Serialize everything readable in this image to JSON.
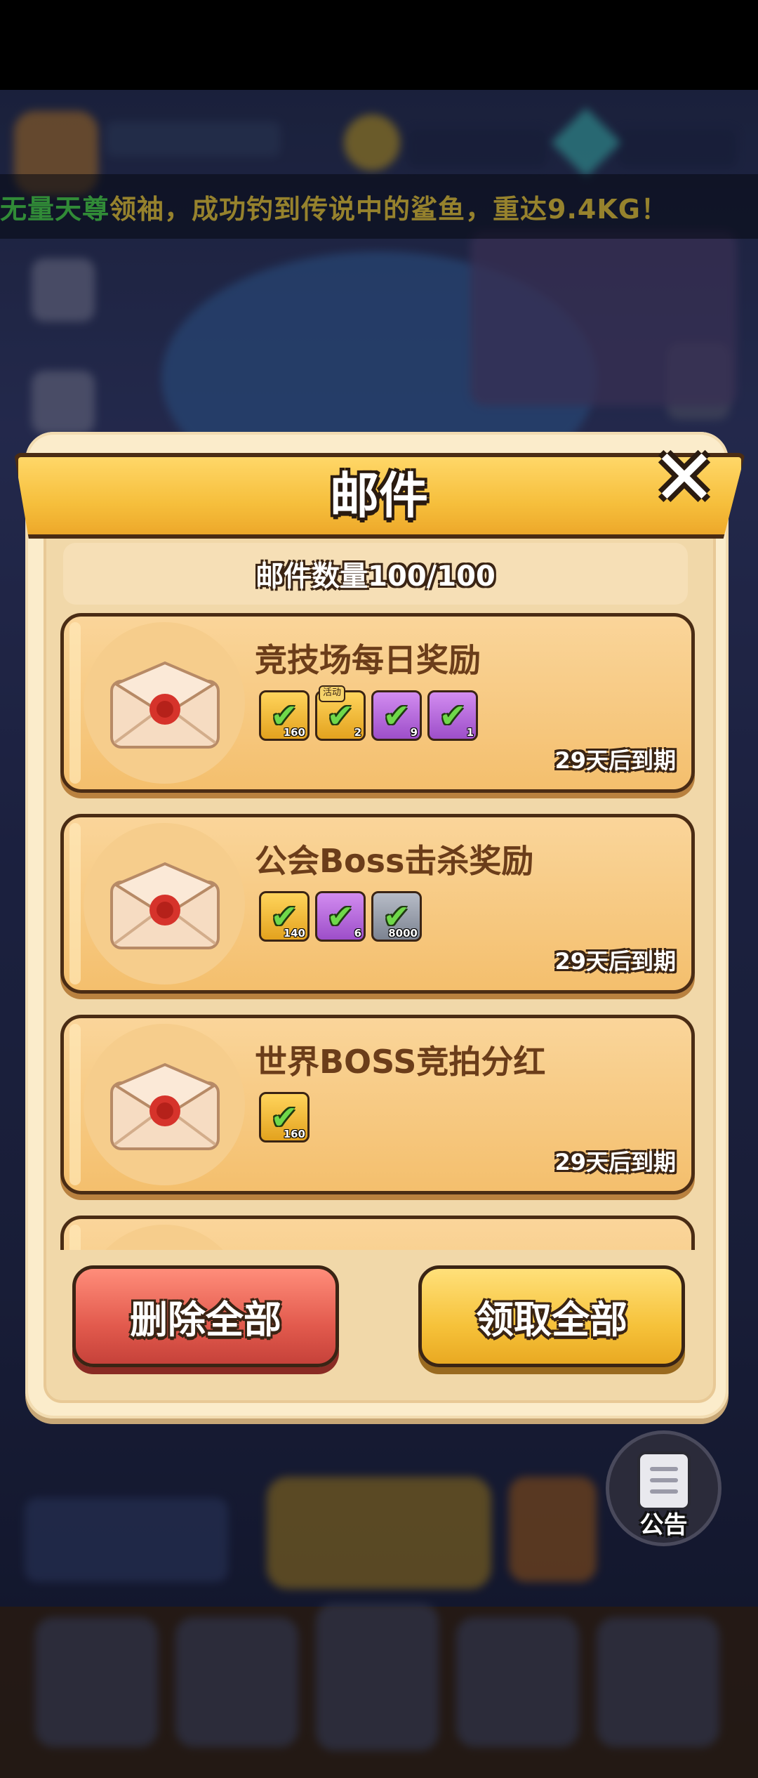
{
  "marquee": {
    "player_name": "无量天尊",
    "message": "领袖，成功钓到传说中的鲨鱼，重达9.4KG！"
  },
  "dialog": {
    "title": "邮件",
    "count_label": "邮件数量100/100"
  },
  "mails": [
    {
      "title": "竞技场每日奖励",
      "expire": "29天后到期",
      "rewards": [
        {
          "style": "gold",
          "count": "160",
          "badge": ""
        },
        {
          "style": "gold",
          "count": "2",
          "badge": "活动"
        },
        {
          "style": "purple",
          "count": "9",
          "badge": ""
        },
        {
          "style": "purple",
          "count": "1",
          "badge": ""
        }
      ]
    },
    {
      "title": "公会Boss击杀奖励",
      "expire": "29天后到期",
      "rewards": [
        {
          "style": "gold",
          "count": "140",
          "badge": ""
        },
        {
          "style": "purple",
          "count": "6",
          "badge": ""
        },
        {
          "style": "grey",
          "count": "8000",
          "badge": ""
        }
      ]
    },
    {
      "title": "世界BOSS竞拍分红",
      "expire": "29天后到期",
      "rewards": [
        {
          "style": "gold",
          "count": "160",
          "badge": ""
        }
      ]
    },
    {
      "title": "",
      "expire": "",
      "rewards": []
    }
  ],
  "buttons": {
    "delete_all": "删除全部",
    "claim_all": "领取全部"
  },
  "notice": {
    "label": "公告"
  },
  "colors": {
    "ribbon": "#f6bf3c",
    "delete": "#e25a4d",
    "claim": "#f6c23a",
    "card": "#f4bf6d",
    "marquee_name": "#4fe05a",
    "marquee_msg": "#f2d24a"
  },
  "icons": {
    "close": "close-icon",
    "reward": "check-icon",
    "envelope": "envelope-icon",
    "notice": "notice-board-icon"
  }
}
